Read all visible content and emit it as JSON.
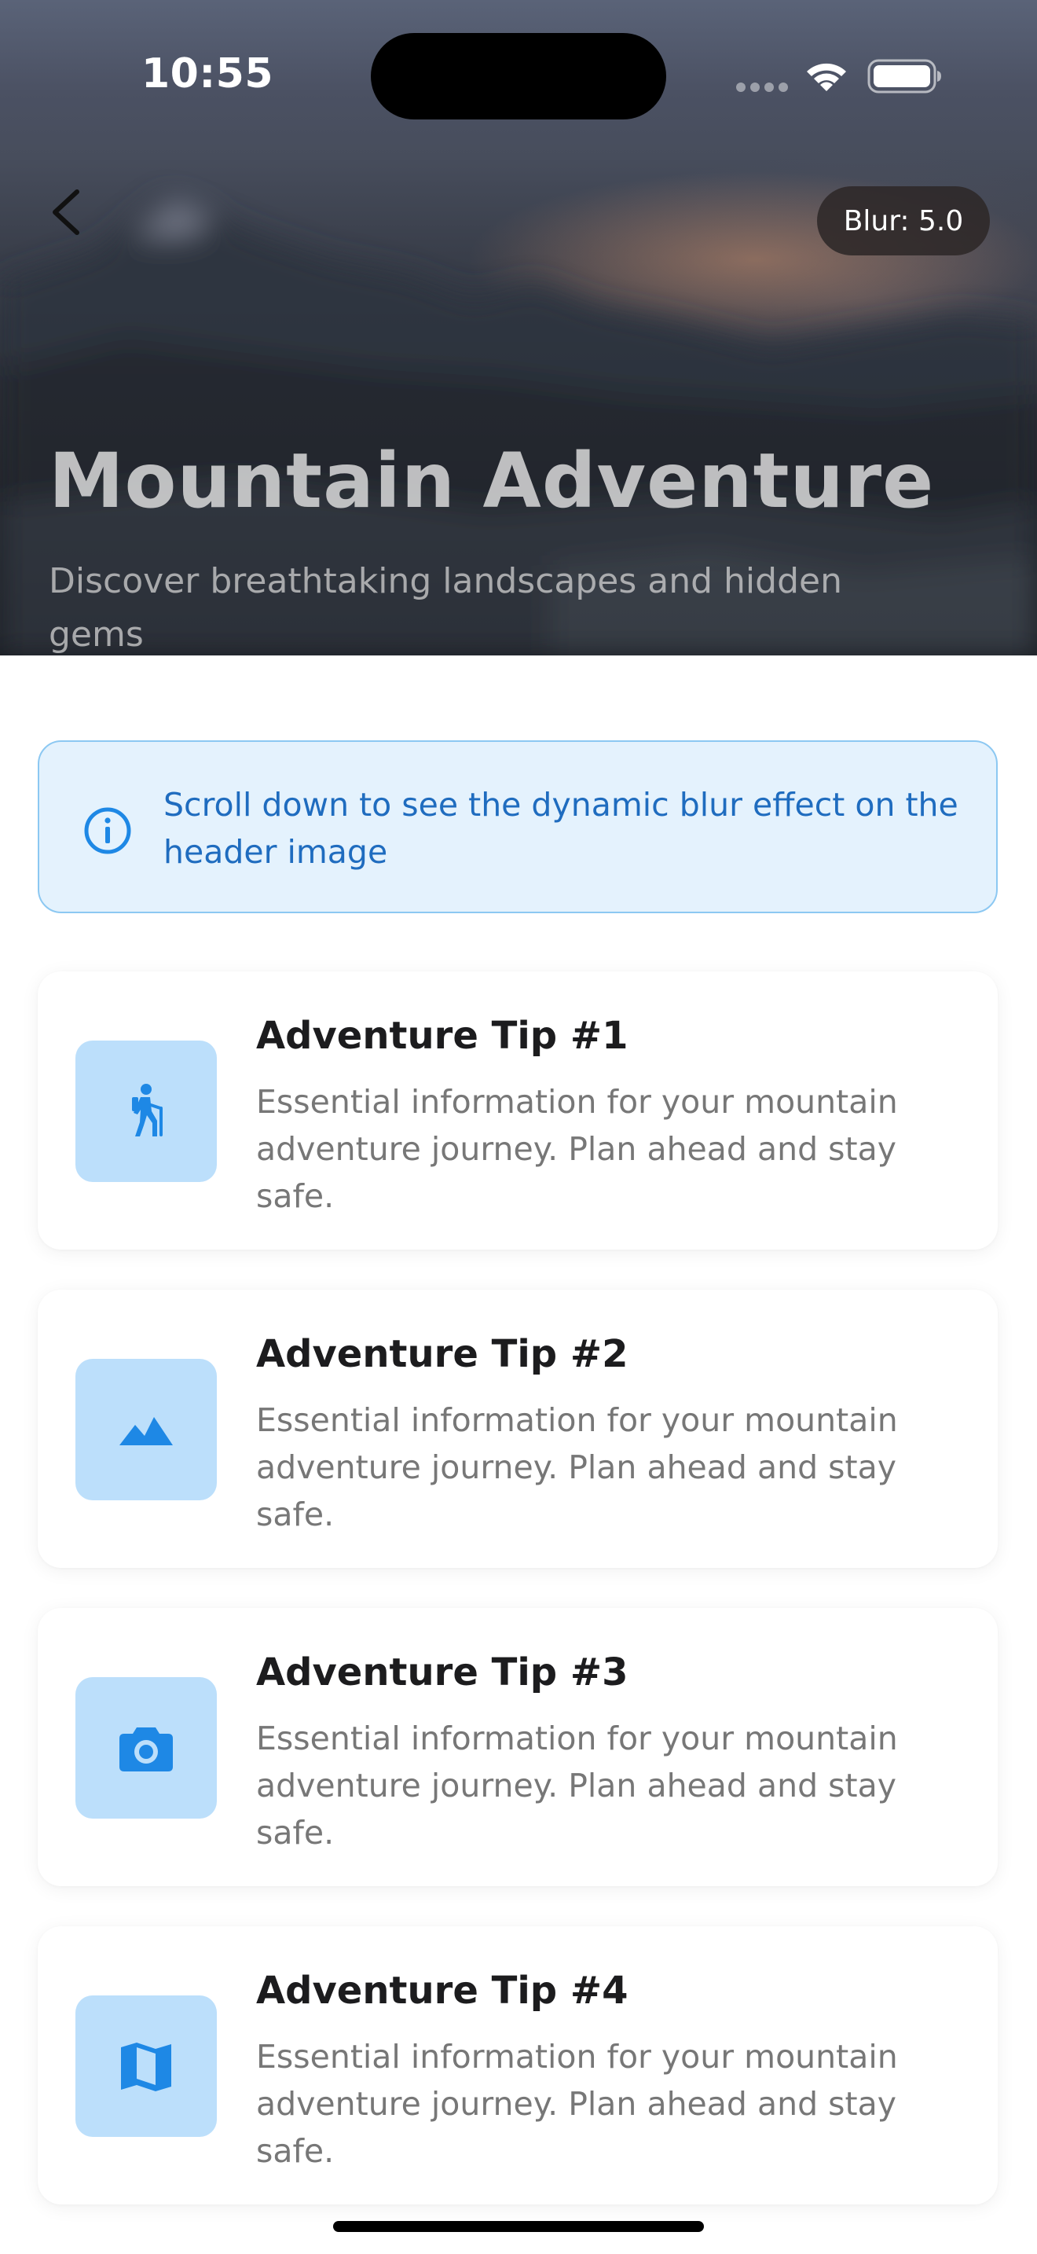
{
  "status_bar": {
    "time": "10:55"
  },
  "header": {
    "back_icon": "chevron-left-icon",
    "blur_badge": "Blur: 5.0",
    "title": "Mountain Adventure",
    "subtitle": "Discover breathtaking landscapes and hidden gems"
  },
  "info_banner": {
    "icon": "info-icon",
    "text": "Scroll down to see the dynamic blur effect on the header image"
  },
  "tips": [
    {
      "title": "Adventure Tip #1",
      "description": "Essential information for your mountain adventure journey. Plan ahead and stay safe.",
      "icon": "hiking-icon"
    },
    {
      "title": "Adventure Tip #2",
      "description": "Essential information for your mountain adventure journey. Plan ahead and stay safe.",
      "icon": "landscape-icon"
    },
    {
      "title": "Adventure Tip #3",
      "description": "Essential information for your mountain adventure journey. Plan ahead and stay safe.",
      "icon": "camera-icon"
    },
    {
      "title": "Adventure Tip #4",
      "description": "Essential information for your mountain adventure journey. Plan ahead and stay safe.",
      "icon": "map-icon"
    }
  ],
  "colors": {
    "accent": "#1e88e5",
    "icon_tile": "#bcdffb",
    "banner_bg": "#e4f2fd",
    "banner_border": "#8cc8f2",
    "banner_text": "#1f6cbf",
    "title_text": "#1c1c1e",
    "body_text": "#777777"
  }
}
